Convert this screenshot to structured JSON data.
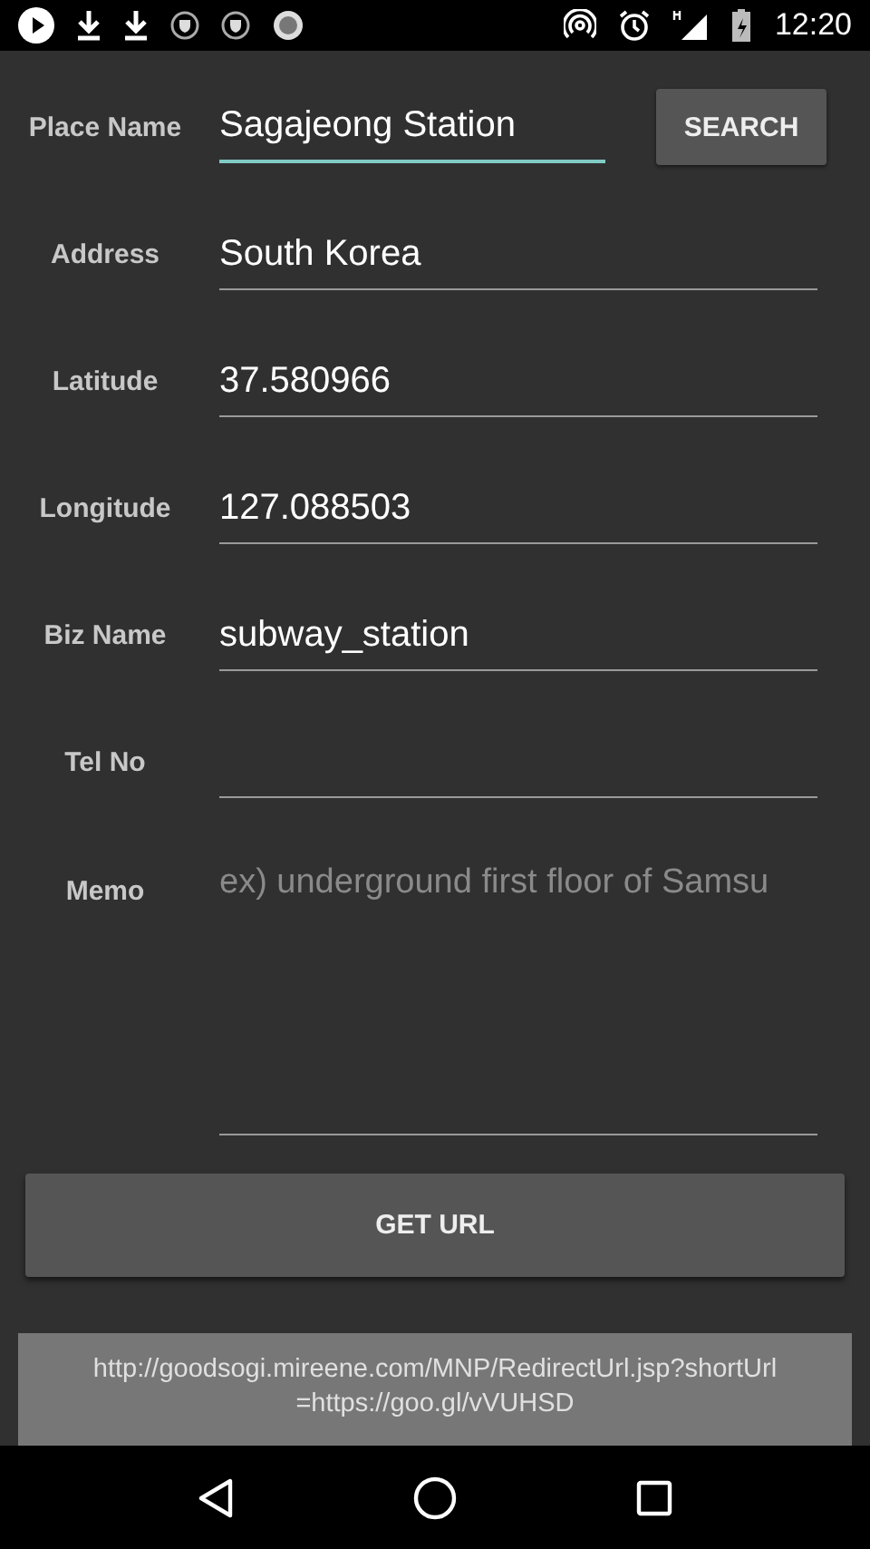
{
  "status_bar": {
    "time": "12:20"
  },
  "fields": [
    {
      "label": "Place Name",
      "value": "Sagajeong Station",
      "focused": true,
      "kind": "search"
    },
    {
      "label": "Address",
      "value": "South Korea",
      "focused": false,
      "kind": "line"
    },
    {
      "label": "Latitude",
      "value": "37.580966",
      "focused": false,
      "kind": "line"
    },
    {
      "label": "Longitude",
      "value": "127.088503",
      "focused": false,
      "kind": "line"
    },
    {
      "label": "Biz Name",
      "value": "subway_station",
      "focused": false,
      "kind": "line"
    },
    {
      "label": "Tel No",
      "focused": false,
      "kind": "line"
    },
    {
      "label": "Memo",
      "placeholder": "ex) underground first floor of Samsu",
      "focused": false,
      "kind": "multiline"
    }
  ],
  "search_button": "SEARCH",
  "get_url_button": "GET URL",
  "result_url": "http://goodsogi.mireene.com/MNP/RedirectUrl.jsp?shortUrl =https://goo.gl/vVUHSD"
}
